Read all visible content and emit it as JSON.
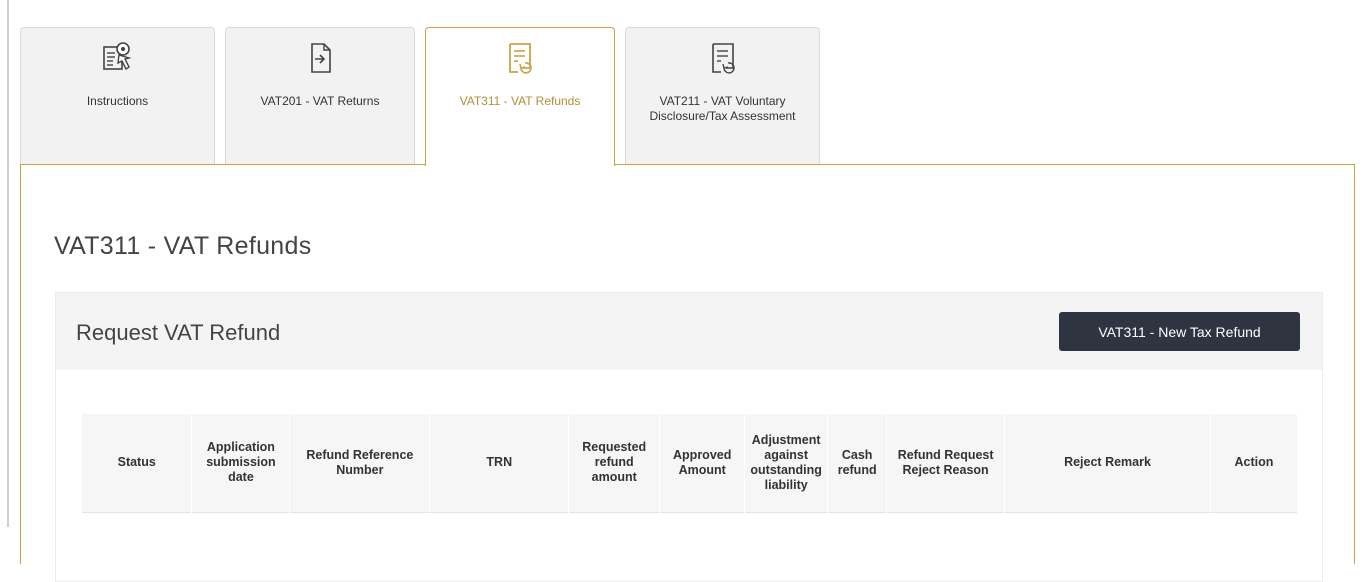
{
  "tabs": [
    {
      "label": "Instructions",
      "icon": "document-search-icon",
      "active": false
    },
    {
      "label": "VAT201 - VAT Returns",
      "icon": "document-return-icon",
      "active": false
    },
    {
      "label": "VAT311 - VAT Refunds",
      "icon": "document-refund-icon",
      "active": true
    },
    {
      "label": "VAT211 - VAT Voluntary Disclosure/Tax Assessment",
      "icon": "document-refund-icon",
      "active": false
    }
  ],
  "page": {
    "title": "VAT311 - VAT Refunds"
  },
  "section": {
    "title": "Request VAT Refund",
    "new_button": "VAT311 - New Tax Refund"
  },
  "table": {
    "columns": [
      "Status",
      "Application submission date",
      "Refund Reference Number",
      "TRN",
      "Requested refund amount",
      "Approved Amount",
      "Adjustment against outstanding liability",
      "Cash refund",
      "Refund Request Reject Reason",
      "Reject Remark",
      "Action"
    ]
  },
  "colors": {
    "accent": "#c9a24a",
    "button_bg": "#2e3440"
  }
}
